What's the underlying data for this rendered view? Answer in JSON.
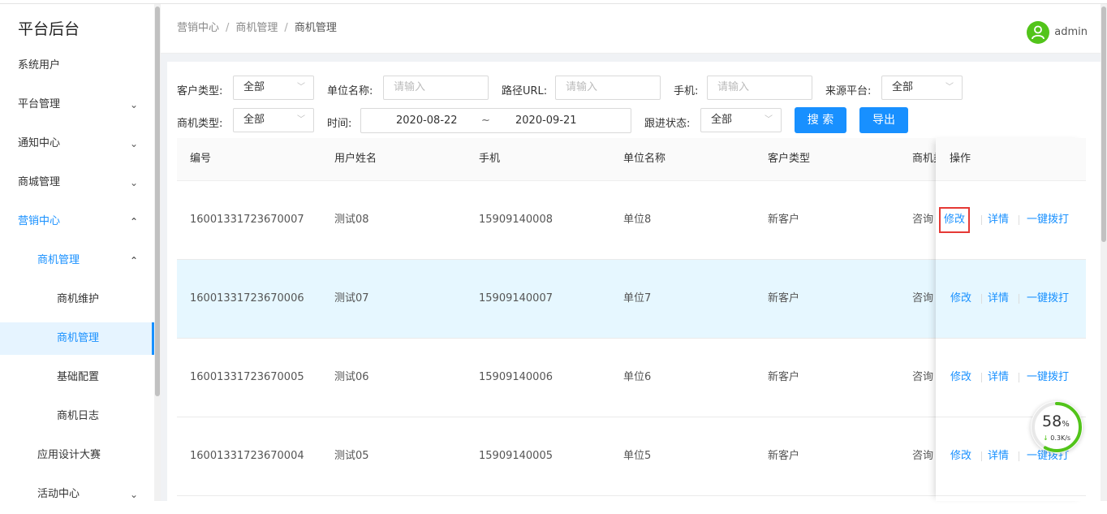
{
  "sidebar": {
    "brand": "平台后台",
    "items": [
      {
        "label": "系统用户",
        "chevron": ""
      },
      {
        "label": "平台管理",
        "chevron": "⌄"
      },
      {
        "label": "通知中心",
        "chevron": "⌄"
      },
      {
        "label": "商城管理",
        "chevron": "⌄"
      },
      {
        "label": "营销中心",
        "chevron": "⌃"
      },
      {
        "label": "商机管理",
        "chevron": "⌃"
      },
      {
        "label": "商机维护",
        "chevron": ""
      },
      {
        "label": "商机管理",
        "chevron": ""
      },
      {
        "label": "基础配置",
        "chevron": ""
      },
      {
        "label": "商机日志",
        "chevron": ""
      },
      {
        "label": "应用设计大赛",
        "chevron": ""
      },
      {
        "label": "活动中心",
        "chevron": "⌄"
      }
    ]
  },
  "header": {
    "breadcrumb": [
      "营销中心",
      "商机管理",
      "商机管理"
    ],
    "breadcrumb_sep": "/",
    "username": "admin"
  },
  "filters": {
    "customer_type": {
      "label": "客户类型:",
      "value": "全部"
    },
    "company_name": {
      "label": "单位名称:",
      "placeholder": "请输入"
    },
    "path_url": {
      "label": "路径URL:",
      "placeholder": "请输入"
    },
    "phone": {
      "label": "手机:",
      "placeholder": "请输入"
    },
    "source": {
      "label": "来源平台:",
      "value": "全部"
    },
    "opp_type": {
      "label": "商机类型:",
      "value": "全部"
    },
    "time": {
      "label": "时间:",
      "start": "2020-08-22",
      "sep": "~",
      "end": "2020-09-21"
    },
    "follow_status": {
      "label": "跟进状态:",
      "value": "全部"
    },
    "search_label": "搜 索",
    "export_label": "导出"
  },
  "table": {
    "columns": [
      "编号",
      "用户姓名",
      "手机",
      "单位名称",
      "客户类型",
      "商机类",
      "操作"
    ],
    "rows": [
      {
        "id": "16001331723670007",
        "name": "测试08",
        "phone": "15909140008",
        "company": "单位8",
        "ctype": "新客户",
        "otype": "咨询"
      },
      {
        "id": "16001331723670006",
        "name": "测试07",
        "phone": "15909140007",
        "company": "单位7",
        "ctype": "新客户",
        "otype": "咨询"
      },
      {
        "id": "16001331723670005",
        "name": "测试06",
        "phone": "15909140006",
        "company": "单位6",
        "ctype": "新客户",
        "otype": "咨询"
      },
      {
        "id": "16001331723670004",
        "name": "测试05",
        "phone": "15909140005",
        "company": "单位5",
        "ctype": "新客户",
        "otype": "咨询"
      }
    ],
    "actions": {
      "edit": "修改",
      "detail": "详情",
      "call": "一键拨打"
    }
  },
  "speed_widget": {
    "percent": "58",
    "unit": "%",
    "arrow": "↓",
    "rate": "0.3K/s",
    "ring_color": "#52c41a",
    "percent_value": 58
  }
}
